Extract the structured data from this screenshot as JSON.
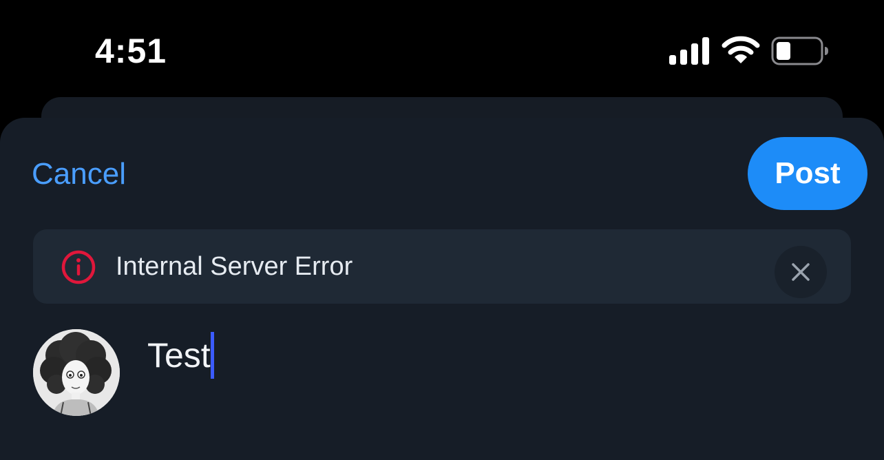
{
  "status_bar": {
    "time": "4:51",
    "icons": [
      "cellular-signal-icon",
      "wifi-icon",
      "battery-icon"
    ],
    "battery_level": 0.3
  },
  "compose": {
    "cancel_label": "Cancel",
    "post_label": "Post",
    "error": {
      "message": "Internal Server Error",
      "icon": "info-circle-icon",
      "dismiss_icon": "close-icon"
    },
    "text_value": "Test"
  },
  "colors": {
    "accent": "#1d8cf8",
    "link": "#4a9eff",
    "error": "#e0173b",
    "sheet_background": "#161d27",
    "banner_background": "#1f2935",
    "caret": "#3b5bff"
  }
}
